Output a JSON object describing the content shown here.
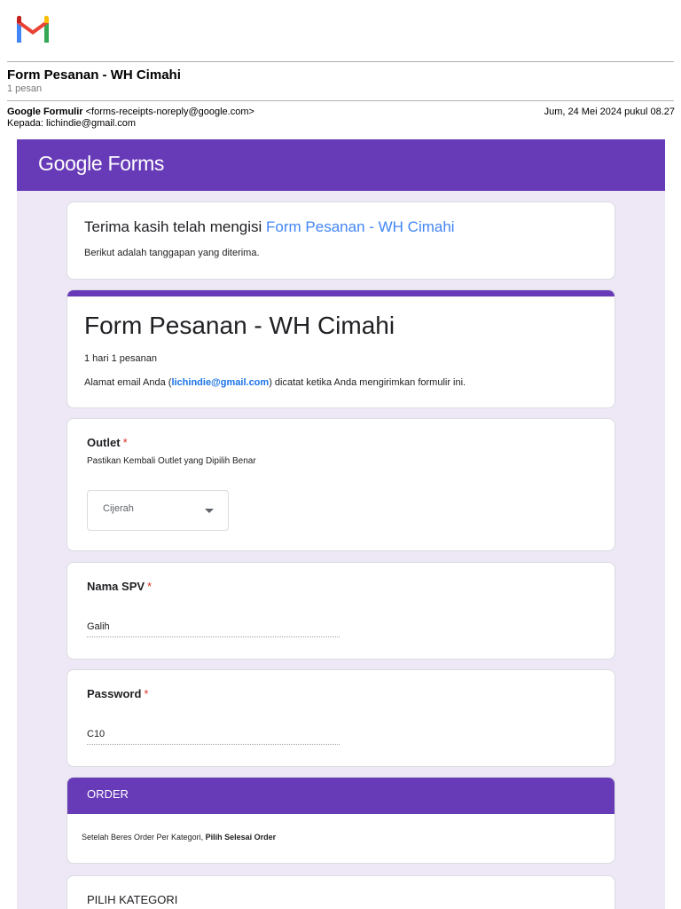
{
  "email": {
    "subject": "Form Pesanan - WH Cimahi",
    "count": "1 pesan",
    "sender_name": "Google Formulir",
    "sender_email": "<forms-receipts-noreply@google.com>",
    "recipient": "Kepada: lichindie@gmail.com",
    "date": "Jum, 24 Mei 2024 pukul 08.27"
  },
  "forms": {
    "logo_google": "Google",
    "logo_forms": "Forms",
    "thanks_prefix": "Terima kasih telah mengisi ",
    "thanks_link": "Form Pesanan - WH Cimahi",
    "thanks_sub": "Berikut adalah tanggapan yang diterima.",
    "form_title": "Form Pesanan - WH Cimahi",
    "form_desc": "1 hari 1 pesanan",
    "email_prefix": "Alamat email Anda (",
    "email_value": "lichindie@gmail.com",
    "email_suffix": ") dicatat ketika Anda mengirimkan formulir ini.",
    "required_mark": "*"
  },
  "questions": {
    "outlet": {
      "title": "Outlet",
      "help": "Pastikan Kembali Outlet yang Dipilih Benar",
      "value": "Cijerah"
    },
    "spv": {
      "title": "Nama SPV",
      "value": "Galih"
    },
    "password": {
      "title": "Password",
      "value": "C10"
    }
  },
  "order": {
    "title": "ORDER",
    "note_prefix": "Setelah Beres Order Per Kategori, ",
    "note_bold": "Pilih Selesai Order"
  },
  "pick": {
    "title": "PILIH KATEGORI"
  },
  "colors": {
    "forms_purple": "#673ab7",
    "forms_bg": "#ede7f6",
    "link_blue": "#4285f4",
    "required_red": "#d93025"
  }
}
